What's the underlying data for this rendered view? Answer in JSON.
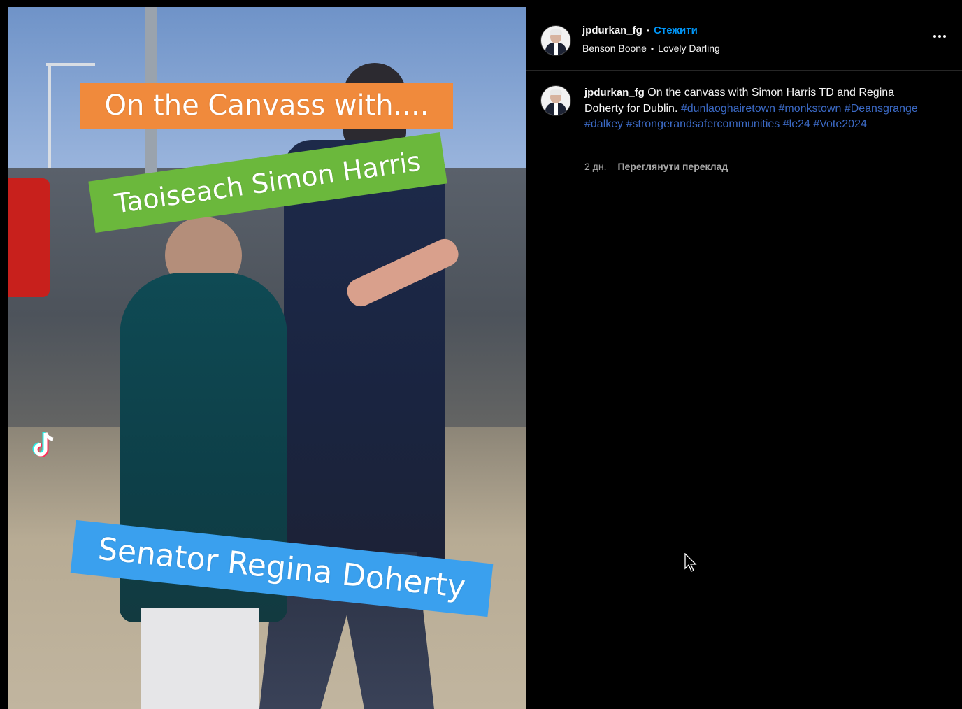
{
  "video": {
    "overlay_top": "On the Canvass with....",
    "overlay_middle": "Taoiseach Simon Harris",
    "overlay_bottom": "Senator Regina Doherty",
    "watermark_icon": "tiktok-logo"
  },
  "header": {
    "username": "jpdurkan_fg",
    "separator": "•",
    "follow_label": "Стежити",
    "audio_artist": "Benson Boone",
    "audio_separator": "•",
    "audio_track": "Lovely Darling",
    "more_icon": "more-horizontal-icon"
  },
  "caption": {
    "username": "jpdurkan_fg",
    "text": "On the canvass with Simon Harris TD and Regina Doherty for Dublin.",
    "hashtags": [
      "#dunlaoghairetown",
      "#monkstown",
      "#Deansgrange",
      "#dalkey",
      "#strongerandsafercommunities",
      "#le24",
      "#Vote2024"
    ],
    "age": "2 дн.",
    "translate_label": "Переглянути переклад"
  },
  "colors": {
    "background": "#000000",
    "text": "#f5f5f5",
    "follow": "#0095f6",
    "hashtag": "#3b69c4",
    "meta": "#a8a8a8",
    "divider": "#262626"
  }
}
